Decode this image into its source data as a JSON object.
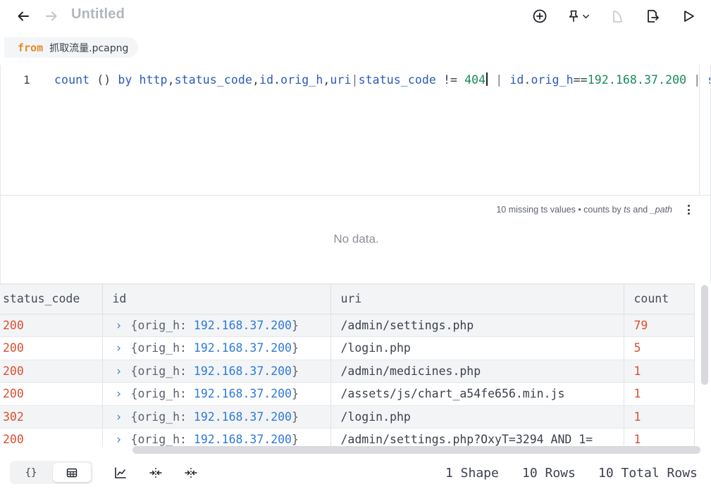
{
  "header": {
    "title": "Untitled",
    "icons": [
      "back-arrow-icon",
      "forward-arrow-icon",
      "add-circle-icon",
      "pin-icon",
      "chevron-down-icon",
      "shape-icon",
      "export-file-icon",
      "run-icon"
    ]
  },
  "from": {
    "keyword": "from",
    "source": "抓取流量.pcapng"
  },
  "editor": {
    "line_number": "1",
    "tokens": {
      "t1": "count",
      "t2": " () ",
      "t3": "by",
      "t4": " ",
      "t5": "http",
      "t6": ",",
      "t7": "status_code",
      "t8": ",",
      "t9": "id",
      "t10": ".",
      "t11": "orig_h",
      "t12": ",",
      "t13": "uri",
      "t14": "|",
      "t15": "status_code",
      "t16": " != ",
      "t17": "404",
      "t18": " | ",
      "t19": "id",
      "t20": ".",
      "t21": "orig_h",
      "t22": "==",
      "t23": "192.168.37.200",
      "t24": " | ",
      "t25": "so"
    }
  },
  "histogram": {
    "caption_prefix": "10 missing ts values • counts by ",
    "caption_ts": "ts",
    "caption_and": " and ",
    "caption_path": "_path",
    "empty_text": "No data."
  },
  "table": {
    "columns": [
      "status_code",
      "id",
      "uri",
      "count"
    ],
    "rows": [
      {
        "status_code": "200",
        "id_key": "orig_h",
        "id_value": "192.168.37.200",
        "uri": "/admin/settings.php",
        "count": "79"
      },
      {
        "status_code": "200",
        "id_key": "orig_h",
        "id_value": "192.168.37.200",
        "uri": "/login.php",
        "count": "5"
      },
      {
        "status_code": "200",
        "id_key": "orig_h",
        "id_value": "192.168.37.200",
        "uri": "/admin/medicines.php",
        "count": "1"
      },
      {
        "status_code": "200",
        "id_key": "orig_h",
        "id_value": "192.168.37.200",
        "uri": "/assets/js/chart_a54fe656.min.js",
        "count": "1"
      },
      {
        "status_code": "302",
        "id_key": "orig_h",
        "id_value": "192.168.37.200",
        "uri": "/login.php",
        "count": "1"
      },
      {
        "status_code": "200",
        "id_key": "orig_h",
        "id_value": "192.168.37.200",
        "uri": "/admin/settings.php?OxyT=3294 AND 1=",
        "count": "1"
      }
    ]
  },
  "footer": {
    "json_view_label": "{}",
    "shape_count": "1 Shape",
    "row_count": "10 Rows",
    "total_rows": "10 Total Rows"
  },
  "colors": {
    "accent_orange": "#e58b28",
    "keyword_blue": "#2a5bb8",
    "number_green": "#1a8a5a",
    "value_red": "#d9502f",
    "ip_blue": "#2f7ad8"
  }
}
